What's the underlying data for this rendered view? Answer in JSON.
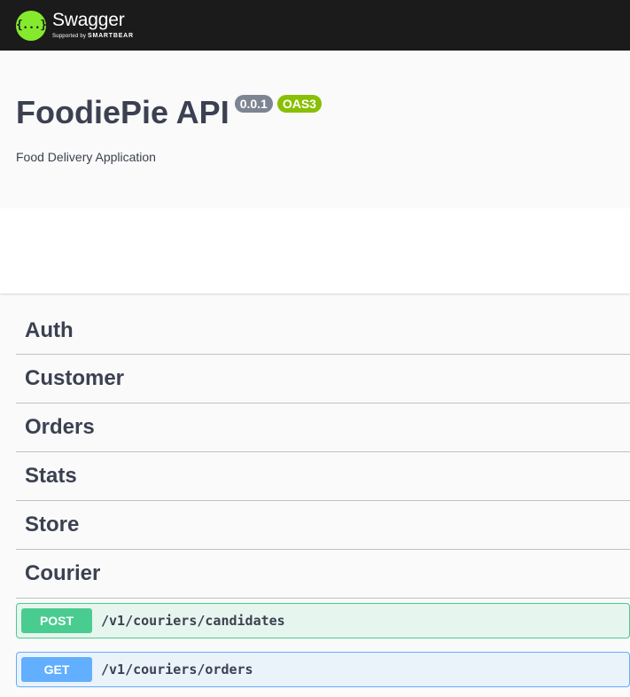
{
  "topbar": {
    "logo_symbol": "{...}",
    "logo_name": "Swagger",
    "logo_sub_prefix": "Supported by",
    "logo_sub_brand": "SMARTBEAR",
    "accent_color": "#85ea2d",
    "background_color": "#1b1b1b"
  },
  "info": {
    "title": "FoodiePie API",
    "version_badge": "0.0.1",
    "oas_badge": "OAS3",
    "description": "Food Delivery Application"
  },
  "tags": [
    {
      "name": "Auth"
    },
    {
      "name": "Customer"
    },
    {
      "name": "Orders"
    },
    {
      "name": "Stats"
    },
    {
      "name": "Store"
    },
    {
      "name": "Courier"
    }
  ],
  "operations": [
    {
      "method": "POST",
      "path": "/v1/couriers/candidates",
      "color": "#49cc90"
    },
    {
      "method": "GET",
      "path": "/v1/couriers/orders",
      "color": "#61affe"
    }
  ]
}
